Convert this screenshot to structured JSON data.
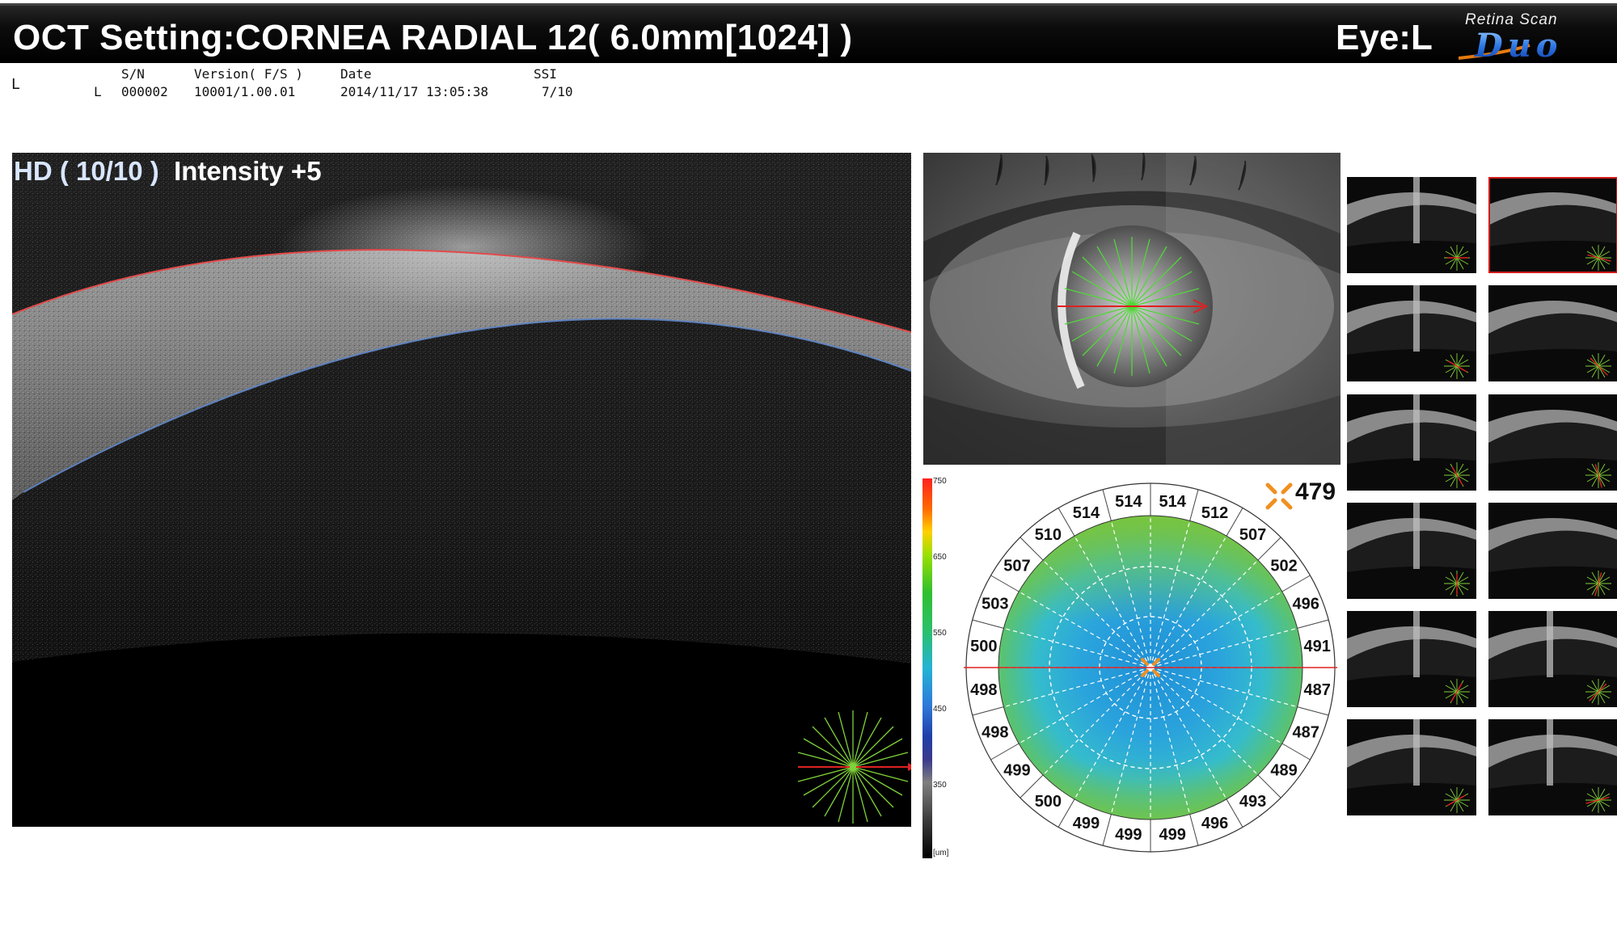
{
  "header": {
    "title": "OCT Setting:CORNEA RADIAL 12( 6.0mm[1024] )",
    "eye": "Eye:L",
    "brand_sub": "Retina Scan",
    "brand_main": "Duo"
  },
  "info": {
    "eye_letter": "L",
    "row_eye": "L",
    "sn_label": "S/N",
    "sn_value": "000002",
    "version_label": "Version( F/S )",
    "version_value": "10001/1.00.01",
    "date_label": "Date",
    "date_value": "2014/11/17 13:05:38",
    "ssi_label": "SSI",
    "ssi_value": "7/10"
  },
  "bscan": {
    "quality_label": "HD ( 10/10 )",
    "intensity_label": "Intensity +5"
  },
  "colorbar": {
    "ticks": [
      "750",
      "650",
      "550",
      "450",
      "350",
      "[um]"
    ]
  },
  "pachymetry": {
    "central_value": "479",
    "rim_values": [
      "514",
      "512",
      "507",
      "502",
      "496",
      "491",
      "487",
      "487",
      "489",
      "493",
      "496",
      "499",
      "499",
      "499",
      "500",
      "499",
      "498",
      "498",
      "500",
      "503",
      "507",
      "510",
      "514",
      "514"
    ]
  },
  "thumbnails": {
    "count": 12,
    "selected_index": 1
  }
}
